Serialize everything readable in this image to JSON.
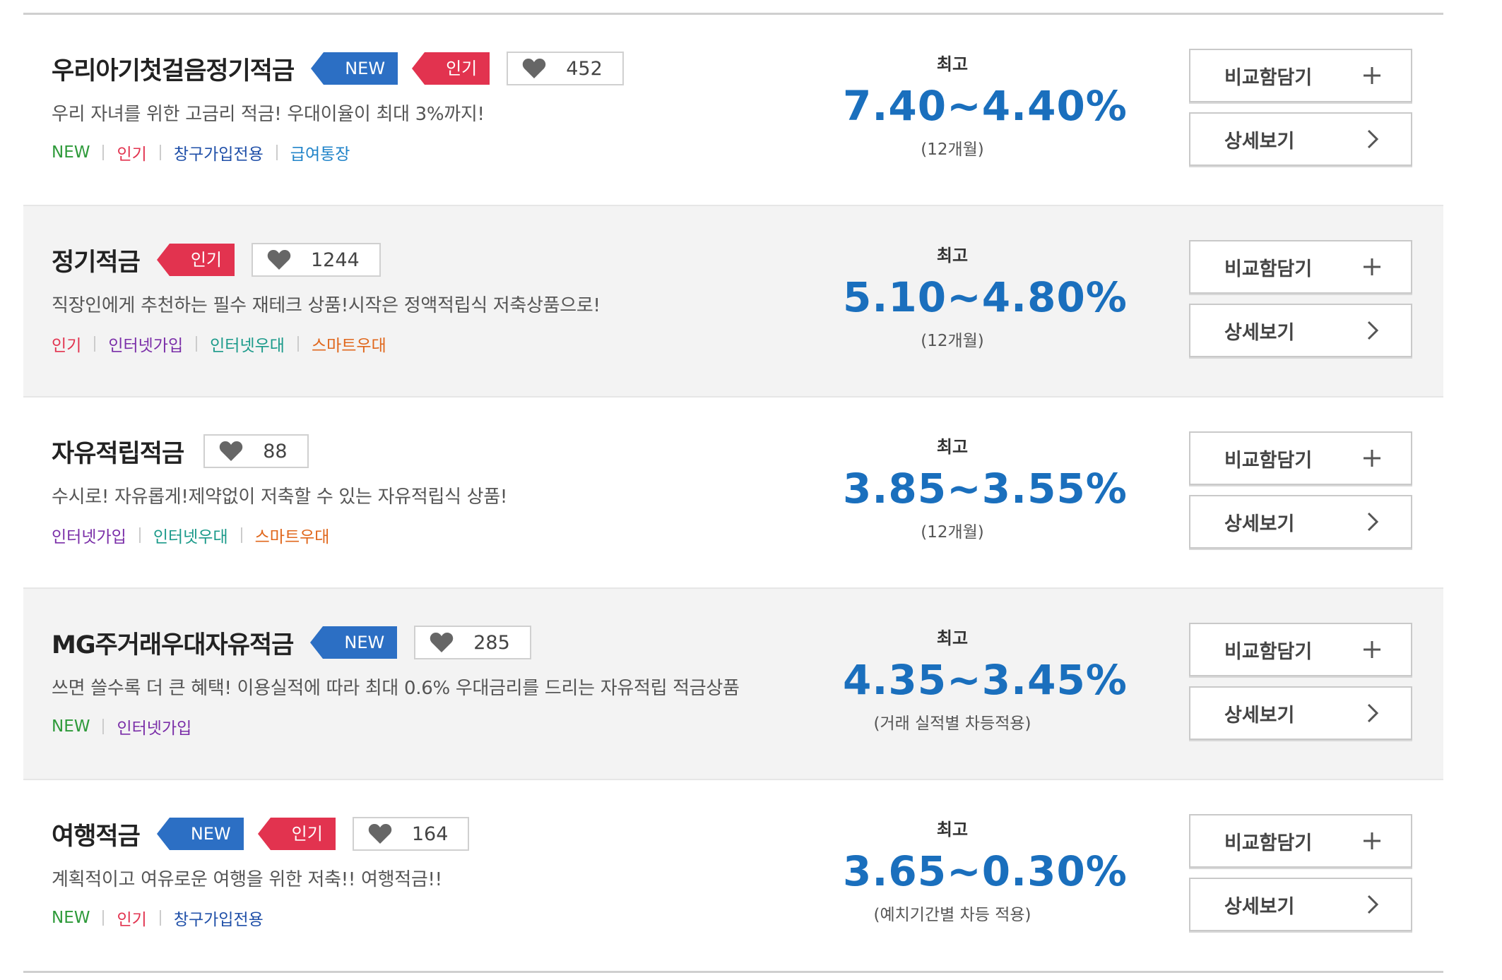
{
  "rate_label": "최고",
  "buttons": {
    "compare": "비교함담기",
    "detail": "상세보기"
  },
  "products": [
    {
      "title": "우리아기첫걸음정기적금",
      "badges": [
        {
          "type": "new",
          "label": "NEW"
        },
        {
          "type": "hot",
          "label": "인기"
        }
      ],
      "likes": "452",
      "desc": "우리 자녀를 위한 고금리 적금! 우대이율이 최대 3%까지!",
      "tags": [
        {
          "label": "NEW",
          "color": "new"
        },
        {
          "label": "인기",
          "color": "hot"
        },
        {
          "label": "창구가입전용",
          "color": "branch"
        },
        {
          "label": "급여통장",
          "color": "salary"
        }
      ],
      "rate": "7.40~4.40%",
      "period": "(12개월)"
    },
    {
      "title": "정기적금",
      "badges": [
        {
          "type": "hot",
          "label": "인기"
        }
      ],
      "likes": "1244",
      "desc": "직장인에게 추천하는 필수 재테크 상품!시작은 정액적립식 저축상품으로!",
      "tags": [
        {
          "label": "인기",
          "color": "hot"
        },
        {
          "label": "인터넷가입",
          "color": "net"
        },
        {
          "label": "인터넷우대",
          "color": "netpref"
        },
        {
          "label": "스마트우대",
          "color": "smart"
        }
      ],
      "rate": "5.10~4.80%",
      "period": "(12개월)"
    },
    {
      "title": "자유적립적금",
      "badges": [],
      "likes": "88",
      "desc": "수시로! 자유롭게!제약없이 저축할 수 있는 자유적립식 상품!",
      "tags": [
        {
          "label": "인터넷가입",
          "color": "net"
        },
        {
          "label": "인터넷우대",
          "color": "netpref"
        },
        {
          "label": "스마트우대",
          "color": "smart"
        }
      ],
      "rate": "3.85~3.55%",
      "period": "(12개월)"
    },
    {
      "title": "MG주거래우대자유적금",
      "badges": [
        {
          "type": "new",
          "label": "NEW"
        }
      ],
      "likes": "285",
      "desc": "쓰면 쓸수록 더 큰 혜택! 이용실적에 따라 최대 0.6% 우대금리를 드리는 자유적립 적금상품",
      "tags": [
        {
          "label": "NEW",
          "color": "new"
        },
        {
          "label": "인터넷가입",
          "color": "net"
        }
      ],
      "rate": "4.35~3.45%",
      "period": "(거래 실적별 차등적용)"
    },
    {
      "title": "여행적금",
      "badges": [
        {
          "type": "new",
          "label": "NEW"
        },
        {
          "type": "hot",
          "label": "인기"
        }
      ],
      "likes": "164",
      "desc": "계획적이고 여유로운 여행을 위한 저축!! 여행적금!!",
      "tags": [
        {
          "label": "NEW",
          "color": "new"
        },
        {
          "label": "인기",
          "color": "hot"
        },
        {
          "label": "창구가입전용",
          "color": "branch"
        }
      ],
      "rate": "3.65~0.30%",
      "period": "(예치기간별 차등 적용)"
    }
  ]
}
